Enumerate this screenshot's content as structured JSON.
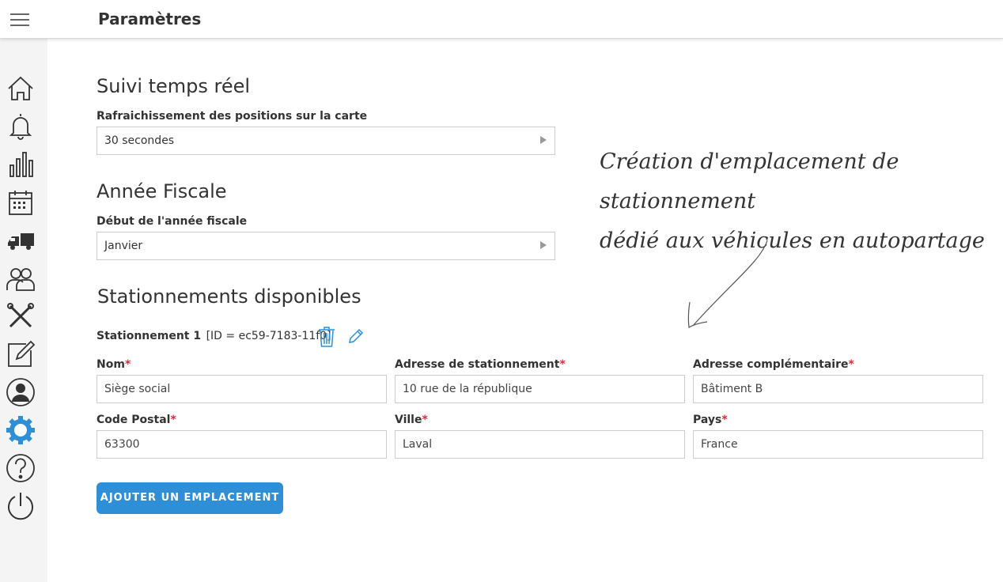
{
  "header": {
    "title": "Paramètres"
  },
  "sidebar": {
    "items": [
      {
        "icon": "home-icon"
      },
      {
        "icon": "bell-icon"
      },
      {
        "icon": "bar-chart-icon"
      },
      {
        "icon": "calendar-icon"
      },
      {
        "icon": "truck-icon"
      },
      {
        "icon": "users-icon"
      },
      {
        "icon": "tools-icon"
      },
      {
        "icon": "edit-icon"
      },
      {
        "icon": "user-icon"
      },
      {
        "icon": "settings-icon",
        "active": true
      },
      {
        "icon": "help-icon"
      },
      {
        "icon": "power-icon"
      }
    ],
    "active_color": "#2e8fd6"
  },
  "realtime": {
    "title": "Suivi temps réel",
    "refresh_label": "Rafraichissement des positions sur la carte",
    "refresh_value": "30 secondes"
  },
  "fiscal": {
    "title": "Année Fiscale",
    "start_label": "Début de l'année fiscale",
    "start_value": "Janvier"
  },
  "parkings": {
    "title": "Stationnements disponibles",
    "item": {
      "name_label": "Stationnement 1",
      "id_text": "[ID = ec59-7183-11f0]",
      "fields": {
        "nom": {
          "label": "Nom",
          "value": "Siège social"
        },
        "adresse": {
          "label": "Adresse de stationnement",
          "value": "10 rue de la république"
        },
        "complement": {
          "label": "Adresse complémentaire",
          "value": "Bâtiment B"
        },
        "cp": {
          "label": "Code Postal",
          "value": "63300"
        },
        "ville": {
          "label": "Ville",
          "value": "Laval"
        },
        "pays": {
          "label": "Pays",
          "value": "France"
        }
      }
    },
    "required_mark": "*",
    "add_button": "AJOUTER UN EMPLACEMENT"
  },
  "annotation": {
    "line1": "Création d'emplacement de stationnement",
    "line2": "dédié aux véhicules en autopartage"
  },
  "colors": {
    "accent": "#2e8fd6",
    "required": "#e0263c"
  }
}
